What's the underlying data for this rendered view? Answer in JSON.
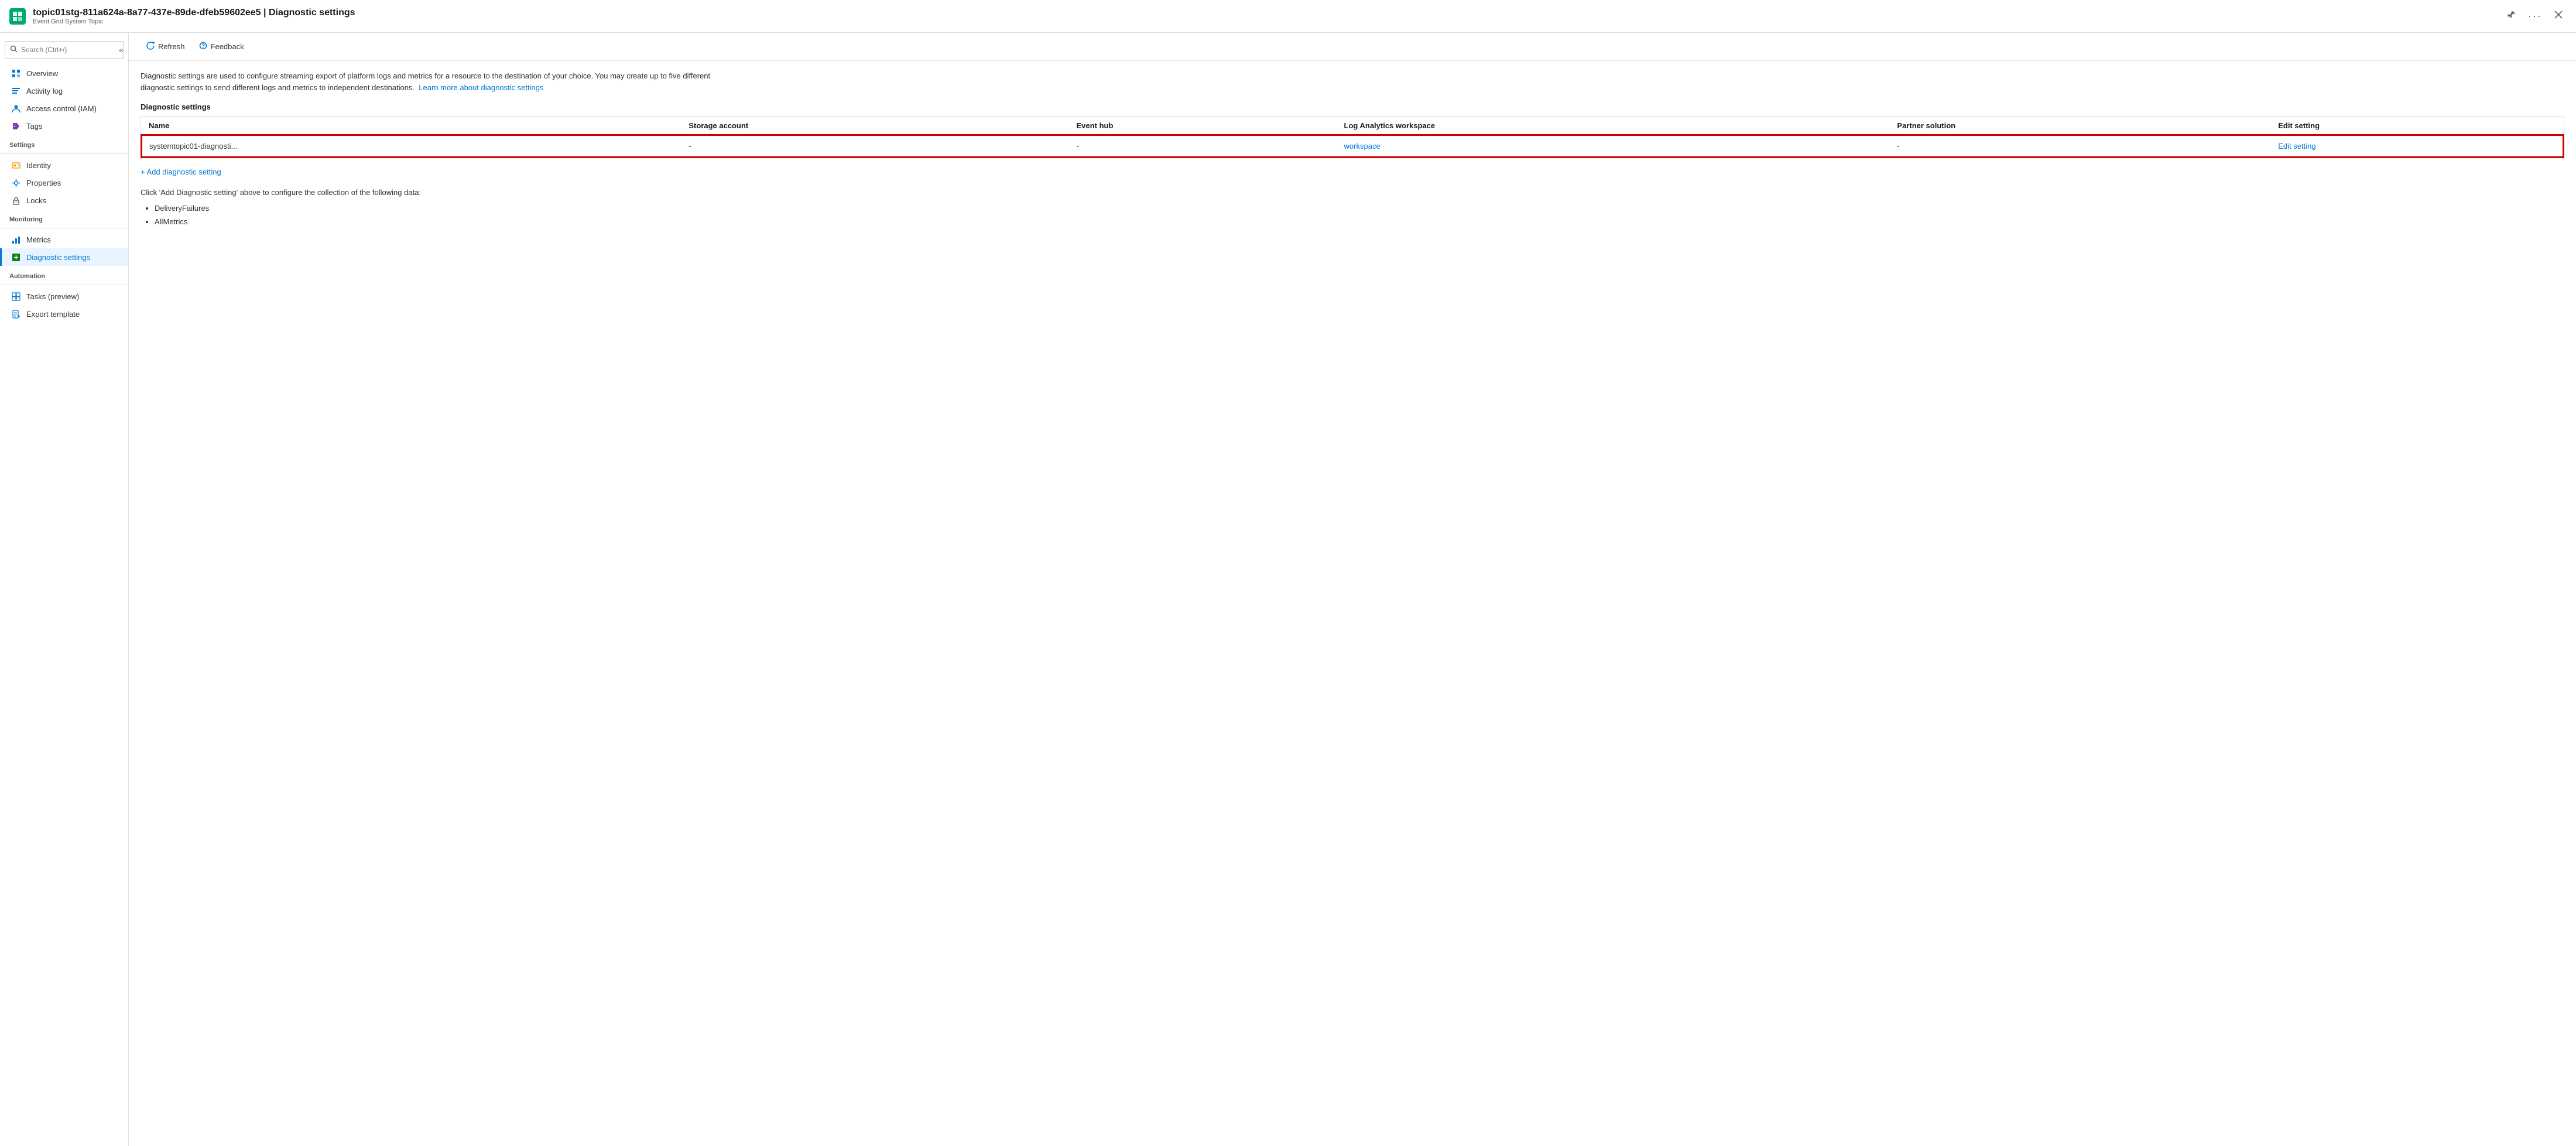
{
  "header": {
    "title": "topic01stg-811a624a-8a77-437e-89de-dfeb59602ee5 | Diagnostic settings",
    "subtitle": "Event Grid System Topic",
    "pin_tooltip": "Pin",
    "more_tooltip": "More",
    "close_tooltip": "Close"
  },
  "sidebar": {
    "search_placeholder": "Search (Ctrl+/)",
    "collapse_label": "«",
    "nav_items": [
      {
        "id": "overview",
        "label": "Overview",
        "icon": "grid-icon",
        "active": false,
        "section": null
      },
      {
        "id": "activitylog",
        "label": "Activity log",
        "icon": "list-icon",
        "active": false,
        "section": null
      },
      {
        "id": "iam",
        "label": "Access control (IAM)",
        "icon": "person-icon",
        "active": false,
        "section": null
      },
      {
        "id": "tags",
        "label": "Tags",
        "icon": "tag-icon",
        "active": false,
        "section": null
      },
      {
        "id": "settings-section",
        "label": "Settings",
        "section": true
      },
      {
        "id": "identity",
        "label": "Identity",
        "icon": "id-icon",
        "active": false,
        "section": false
      },
      {
        "id": "properties",
        "label": "Properties",
        "icon": "sliders-icon",
        "active": false,
        "section": false
      },
      {
        "id": "locks",
        "label": "Locks",
        "icon": "lock-icon",
        "active": false,
        "section": false
      },
      {
        "id": "monitoring-section",
        "label": "Monitoring",
        "section": true
      },
      {
        "id": "metrics",
        "label": "Metrics",
        "icon": "chart-icon",
        "active": false,
        "section": false
      },
      {
        "id": "diagnosticsettings",
        "label": "Diagnostic settings",
        "icon": "diag-icon",
        "active": true,
        "section": false
      },
      {
        "id": "automation-section",
        "label": "Automation",
        "section": true
      },
      {
        "id": "tasks",
        "label": "Tasks (preview)",
        "icon": "tasks-icon",
        "active": false,
        "section": false
      },
      {
        "id": "exporttemplate",
        "label": "Export template",
        "icon": "export-icon",
        "active": false,
        "section": false
      }
    ]
  },
  "toolbar": {
    "refresh_label": "Refresh",
    "feedback_label": "Feedback"
  },
  "content": {
    "description": "Diagnostic settings are used to configure streaming export of platform logs and metrics for a resource to the destination of your choice. You may create up to five different diagnostic settings to send different logs and metrics to independent destinations.",
    "learn_more_link": "Learn more about diagnostic settings",
    "section_title": "Diagnostic settings",
    "table": {
      "columns": [
        "Name",
        "Storage account",
        "Event hub",
        "Log Analytics workspace",
        "Partner solution",
        "Edit setting"
      ],
      "rows": [
        {
          "name": "systemtopic01-diagnosti...",
          "storage_account": "-",
          "event_hub": "-",
          "log_analytics_workspace": "workspace",
          "partner_solution": "-",
          "edit_setting": "Edit setting",
          "highlighted": true
        }
      ]
    },
    "add_link": "+ Add diagnostic setting",
    "collect_desc": "Click 'Add Diagnostic setting' above to configure the collection of the following data:",
    "bullet_items": [
      "DeliveryFailures",
      "AllMetrics"
    ]
  }
}
